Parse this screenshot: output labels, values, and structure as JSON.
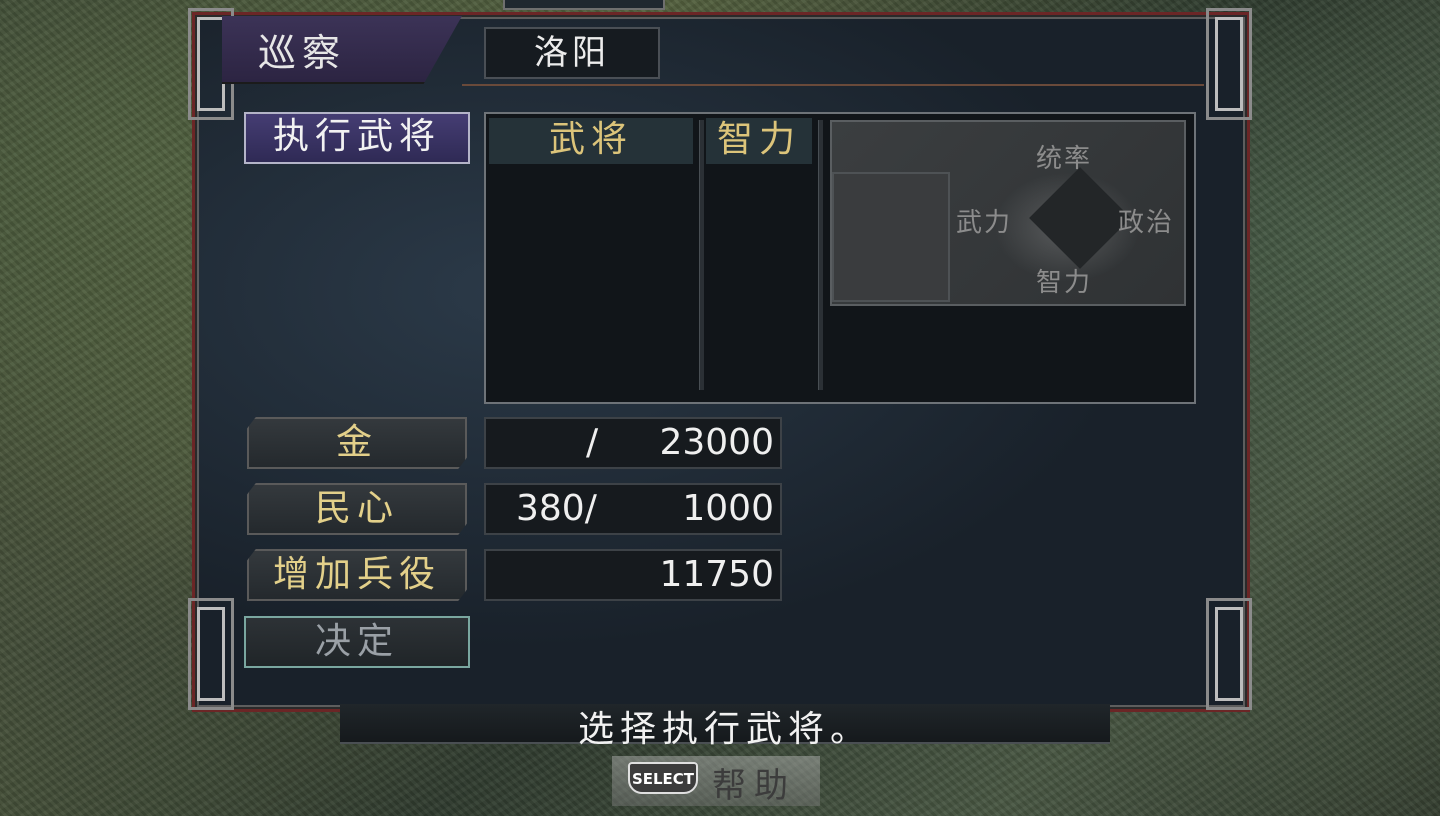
{
  "header": {
    "command_title": "巡察",
    "city": "洛阳"
  },
  "left_panel": {
    "exec_button": "执行武将",
    "gold_label": "金",
    "heart_label": "民心",
    "troops_label": "增加兵役",
    "decide_button": "决定"
  },
  "list": {
    "col_general": "武将",
    "col_intelligence": "智力"
  },
  "radar": {
    "command": "统率",
    "war": "武力",
    "politics": "政治",
    "intelligence": "智力"
  },
  "values": {
    "gold_current": "",
    "gold_slash": "/",
    "gold_max": "23000",
    "heart_current": "380/",
    "heart_max": "1000",
    "troops": "11750"
  },
  "footer": {
    "help_message": "选择执行武将。",
    "select_key": "SELECT",
    "help_label": "帮助"
  },
  "colors": {
    "frame_red": "#6b2626",
    "exec_purple": "#453d73",
    "gold_text": "#dcc47a"
  }
}
